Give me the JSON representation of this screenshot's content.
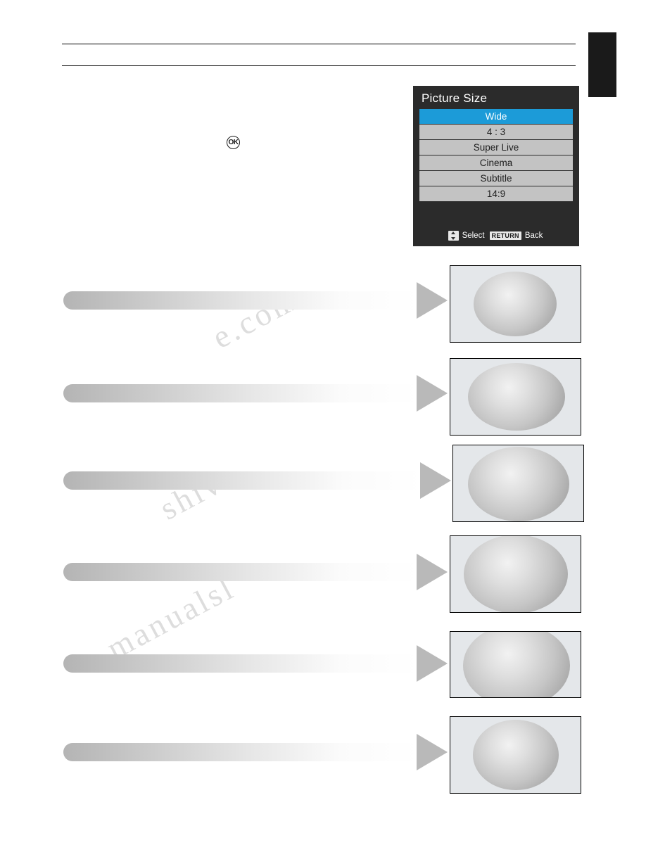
{
  "osd": {
    "title": "Picture Size",
    "items": [
      {
        "label": "Wide",
        "selected": true
      },
      {
        "label": "4 : 3",
        "selected": false
      },
      {
        "label": "Super Live",
        "selected": false
      },
      {
        "label": "Cinema",
        "selected": false
      },
      {
        "label": "Subtitle",
        "selected": false
      },
      {
        "label": "14:9",
        "selected": false
      }
    ],
    "footer": {
      "select_label": "Select",
      "back_label": "Back",
      "return_key": "RETURN",
      "nav_icon": "up-down-arrows-icon"
    },
    "accent_color": "#1c9bd8",
    "background_color": "#2b2b2b",
    "item_color": "#c3c3c3"
  },
  "ok_button": {
    "label": "OK",
    "icon": "ok-button-icon"
  },
  "watermark": {
    "line1": "e.com",
    "line2": "shive",
    "line3": "manualsl"
  },
  "rows": [
    {
      "name": "row-wide"
    },
    {
      "name": "row-4-3"
    },
    {
      "name": "row-super-live"
    },
    {
      "name": "row-cinema"
    },
    {
      "name": "row-subtitle"
    },
    {
      "name": "row-14-9"
    }
  ]
}
